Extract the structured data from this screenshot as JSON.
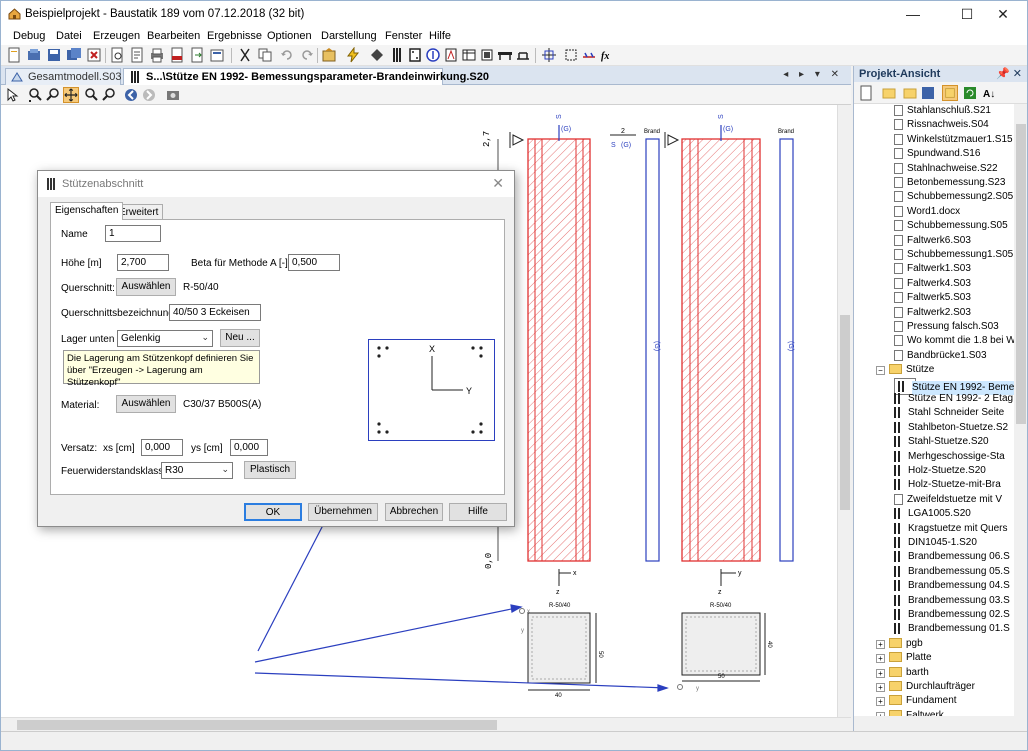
{
  "window": {
    "title": "Beispielprojekt - Baustatik 189 vom 07.12.2018 (32 bit)",
    "minimize": "—",
    "maximize": "☐",
    "close": "✕"
  },
  "menu": [
    "Debug",
    "Datei",
    "Erzeugen",
    "Bearbeiten",
    "Ergebnisse",
    "Optionen",
    "Darstellung",
    "Fenster",
    "Hilfe"
  ],
  "tabs": [
    {
      "label": "Gesamtmodell.S03"
    },
    {
      "label": "S...\\Stütze EN 1992- Bemessungsparameter-Brandeinwirkung.S20"
    }
  ],
  "tabnav": "◂ ▸ ▾ ✕",
  "panel": {
    "title": "Projekt-Ansicht",
    "pin": "📌 ✕",
    "items": [
      {
        "label": "Stahlanschluß.S21",
        "type": "doc",
        "indent": 1
      },
      {
        "label": "Rissnachweis.S04",
        "type": "doc",
        "indent": 1
      },
      {
        "label": "Winkelstützmauer1.S15",
        "type": "doc",
        "indent": 1
      },
      {
        "label": "Spundwand.S16",
        "type": "doc",
        "indent": 1
      },
      {
        "label": "Stahlnachweise.S22",
        "type": "doc",
        "indent": 1
      },
      {
        "label": "Betonbemessung.S23",
        "type": "doc",
        "indent": 1
      },
      {
        "label": "Schubbemessung2.S05",
        "type": "doc",
        "indent": 1
      },
      {
        "label": "Word1.docx",
        "type": "doc",
        "indent": 1
      },
      {
        "label": "Schubbemessung.S05",
        "type": "doc",
        "indent": 1
      },
      {
        "label": "Faltwerk6.S03",
        "type": "doc",
        "indent": 1
      },
      {
        "label": "Schubbemessung1.S05",
        "type": "doc",
        "indent": 1
      },
      {
        "label": "Faltwerk1.S03",
        "type": "doc",
        "indent": 1
      },
      {
        "label": "Faltwerk4.S03",
        "type": "doc",
        "indent": 1
      },
      {
        "label": "Faltwerk5.S03",
        "type": "doc",
        "indent": 1
      },
      {
        "label": "Faltwerk2.S03",
        "type": "doc",
        "indent": 1
      },
      {
        "label": "Pressung falsch.S03",
        "type": "doc",
        "indent": 1
      },
      {
        "label": "Wo kommt die 1.8 bei Wi",
        "type": "doc",
        "indent": 1
      },
      {
        "label": "Bandbrücke1.S03",
        "type": "doc",
        "indent": 1
      },
      {
        "label": "Stütze",
        "type": "folder",
        "indent": 0,
        "exp": "−"
      },
      {
        "label": "Stütze EN 1992- Beme",
        "type": "col",
        "indent": 1,
        "selected": true
      },
      {
        "label": "Stütze EN 1992- 2 Etag",
        "type": "col",
        "indent": 1
      },
      {
        "label": "Stahl Schneider Seite",
        "type": "col",
        "indent": 1
      },
      {
        "label": "Stahlbeton-Stuetze.S2",
        "type": "col",
        "indent": 1
      },
      {
        "label": "Stahl-Stuetze.S20",
        "type": "col",
        "indent": 1
      },
      {
        "label": "Merhgeschossige-Sta",
        "type": "col",
        "indent": 1
      },
      {
        "label": "Holz-Stuetze.S20",
        "type": "col",
        "indent": 1
      },
      {
        "label": "Holz-Stuetze-mit-Bra",
        "type": "col",
        "indent": 1
      },
      {
        "label": "Zweifeldstuetze mit V",
        "type": "doc",
        "indent": 1
      },
      {
        "label": "LGA1005.S20",
        "type": "col",
        "indent": 1
      },
      {
        "label": "Kragstuetze mit Quers",
        "type": "col",
        "indent": 1
      },
      {
        "label": "DIN1045-1.S20",
        "type": "col",
        "indent": 1
      },
      {
        "label": "Brandbemessung 06.S",
        "type": "col",
        "indent": 1
      },
      {
        "label": "Brandbemessung 05.S",
        "type": "col",
        "indent": 1
      },
      {
        "label": "Brandbemessung 04.S",
        "type": "col",
        "indent": 1
      },
      {
        "label": "Brandbemessung 03.S",
        "type": "col",
        "indent": 1
      },
      {
        "label": "Brandbemessung 02.S",
        "type": "col",
        "indent": 1
      },
      {
        "label": "Brandbemessung 01.S",
        "type": "col",
        "indent": 1
      },
      {
        "label": "pgb",
        "type": "folder",
        "indent": 0,
        "exp": "+"
      },
      {
        "label": "Platte",
        "type": "folder",
        "indent": 0,
        "exp": "+"
      },
      {
        "label": "barth",
        "type": "folder",
        "indent": 0,
        "exp": "+"
      },
      {
        "label": "Durchlaufträger",
        "type": "folder",
        "indent": 0,
        "exp": "+"
      },
      {
        "label": "Fundament",
        "type": "folder",
        "indent": 0,
        "exp": "+"
      },
      {
        "label": "Faltwerk",
        "type": "folder",
        "indent": 0,
        "exp": "+"
      }
    ]
  },
  "dialog": {
    "title": "Stützenabschnitt",
    "close": "✕",
    "tabs": [
      "Eigenschaften",
      "Erweitert"
    ],
    "name_label": "Name",
    "name_value": "1",
    "hoehe_label": "Höhe [m]",
    "hoehe_value": "2,700",
    "beta_label": "Beta für Methode A [-]",
    "beta_value": "0,500",
    "querschnitt_label": "Querschnitt:",
    "auswaehlen": "Auswählen",
    "querschnitt_value": "R-50/40",
    "qbez_label": "Querschnittsbezeichnung",
    "qbez_value": "40/50 3 Eckeisen",
    "lager_label": "Lager unten",
    "lager_value": "Gelenkig",
    "neu": "Neu ...",
    "hint": "Die Lagerung am Stützenkopf definieren Sie über \"Erzeugen -> Lagerung am Stützenkopf\"",
    "material_label": "Material:",
    "material_value": "C30/37 B500S(A)",
    "versatz_label": "Versatz:",
    "xs_label": "xs [cm]",
    "xs_value": "0,000",
    "ys_label": "ys [cm]",
    "ys_value": "0,000",
    "fw_label": "Feuerwiderstandsklasse",
    "fw_value": "R30",
    "plastisch": "Plastisch",
    "ok": "OK",
    "uebernehmen": "Übernehmen",
    "abbrechen": "Abbrechen",
    "hilfe": "Hilfe",
    "cs_x": "X",
    "cs_y": "Y"
  },
  "drawing": {
    "dim_top": "2,7",
    "dim_bottom": "0,0",
    "s_label": "S",
    "g_label": "(G)",
    "two_label": "2",
    "brand": "Brand",
    "section_label": "R-50/40",
    "dim_50": "50",
    "dim_40": "40",
    "axis_x": "x",
    "axis_y": "y",
    "axis_z": "z"
  },
  "colors": {
    "accent": "#2b3fbf",
    "hatch": "#e03030",
    "brand_line": "#2b3fbf"
  }
}
